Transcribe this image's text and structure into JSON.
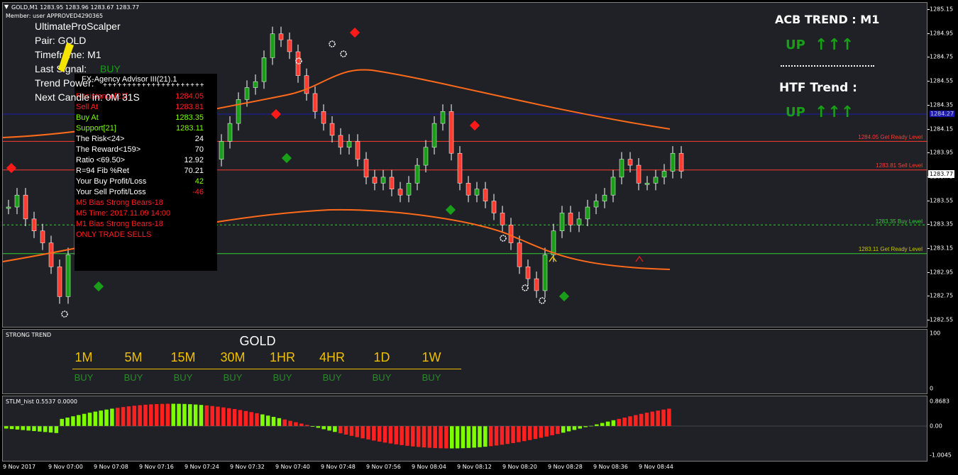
{
  "header": {
    "symbol_line": "GOLD,M1  1283.95 1283.96 1283.67 1283.77",
    "member_line": "Member:  user   APPROVED4290365"
  },
  "scalper": {
    "title": "UltimateProScalper",
    "pair": "Pair: GOLD",
    "timeframe": "Timeframe: M1",
    "last_signal_label": "Last Signal:",
    "last_signal_value": "BUY",
    "trend_power": "Trend Power:",
    "next_candle": "Next Candle in: 0M 31S"
  },
  "advisor": {
    "title": "FX-Agency Advisor III(21).1",
    "dashes": "+++++++++++++++++++++",
    "rows": [
      {
        "label": "Resistance[21]",
        "value": "1284.05",
        "color": "#ff2020"
      },
      {
        "label": "Sell At",
        "value": "1283.81",
        "color": "#ff2020"
      },
      {
        "label": "Buy At",
        "value": "1283.35",
        "color": "#7fff00"
      },
      {
        "label": "Support[21]",
        "value": "1283.11",
        "color": "#7fff00"
      },
      {
        "label": "The Risk<24>",
        "value": "24",
        "color": "#ffffff"
      },
      {
        "label": "The Reward<159>",
        "value": "70",
        "color": "#ffffff"
      },
      {
        "label": "Ratio <69.50>",
        "value": "12.92",
        "color": "#ffffff"
      },
      {
        "label": "R=94 Fib %Ret",
        "value": "70.21",
        "color": "#ffffff"
      },
      {
        "label": "Your Buy Profit/Loss",
        "value": "42",
        "color": "#7fff00",
        "labelColor": "#ffffff"
      },
      {
        "label": "Your Sell Profit/Loss",
        "value": "-46",
        "color": "#ff2020",
        "labelColor": "#ffffff"
      },
      {
        "label": "M5 Bias Strong Bears-18",
        "value": "",
        "color": "#ff2020"
      },
      {
        "label": "M5 Time: 2017.11.09 14:00",
        "value": "",
        "color": "#ff2020"
      },
      {
        "label": "M1 Bias Strong Bears-18",
        "value": "",
        "color": "#ff2020"
      },
      {
        "label": "ONLY TRADE SELLS",
        "value": "",
        "color": "#ff2020"
      }
    ]
  },
  "acb": {
    "title": "ACB TREND :  M1",
    "up1": "UP",
    "arrows1": "↑↑↑",
    "htf_title": "HTF Trend :",
    "up2": "UP",
    "arrows2": "↑↑↑"
  },
  "levels": {
    "get_ready_high": "1284.05 Get Ready Level",
    "sell_level": "1283.81 Sell Level",
    "buy_level": "1283.35 Buy Level",
    "get_ready_low": "1283.11 Get Ready Level"
  },
  "price_axis": {
    "ticks": [
      "1285.15",
      "1284.95",
      "1284.75",
      "1284.55",
      "1284.35",
      "1284.15",
      "1283.95",
      "1283.75",
      "1283.55",
      "1283.35",
      "1283.15",
      "1282.95",
      "1282.75",
      "1282.55"
    ],
    "current": "1283.77",
    "blue_line": "1284.27"
  },
  "strong_trend": {
    "title": "STRONG TREND",
    "pair": "GOLD",
    "timeframes": [
      {
        "tf": "1M",
        "signal": "BUY"
      },
      {
        "tf": "5M",
        "signal": "BUY"
      },
      {
        "tf": "15M",
        "signal": "BUY"
      },
      {
        "tf": "30M",
        "signal": "BUY"
      },
      {
        "tf": "1HR",
        "signal": "BUY"
      },
      {
        "tf": "4HR",
        "signal": "BUY"
      },
      {
        "tf": "1D",
        "signal": "BUY"
      },
      {
        "tf": "1W",
        "signal": "BUY"
      }
    ],
    "axis_top": "100",
    "axis_bottom": "0"
  },
  "stlm": {
    "title": "STLM_hist 0.5537 0.0000",
    "axis": [
      "0.8683",
      "0.00",
      "-1.0045"
    ]
  },
  "time_axis": [
    "9 Nov 2017",
    "9 Nov 07:00",
    "9 Nov 07:08",
    "9 Nov 07:16",
    "9 Nov 07:24",
    "9 Nov 07:32",
    "9 Nov 07:40",
    "9 Nov 07:48",
    "9 Nov 07:56",
    "9 Nov 08:04",
    "9 Nov 08:12",
    "9 Nov 08:20",
    "9 Nov 08:28",
    "9 Nov 08:36",
    "9 Nov 08:44"
  ],
  "colors": {
    "bull": "#1a9e1a",
    "bear": "#ff3b30",
    "ma": "#ff6a1a",
    "hist_up": "#7fff00",
    "hist_down": "#ff2020",
    "gold_text": "#f0c000"
  }
}
